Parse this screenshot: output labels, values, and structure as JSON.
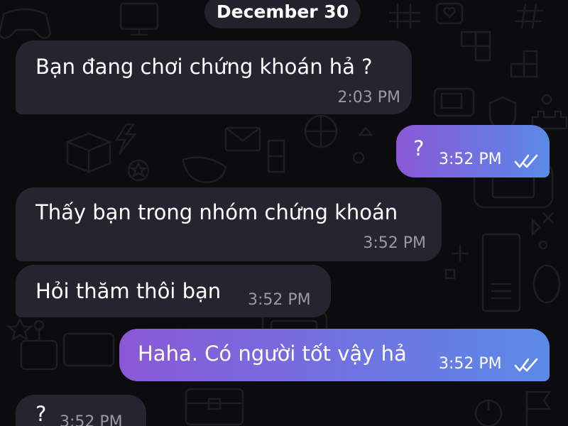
{
  "date_separator": "December 30",
  "messages": [
    {
      "direction": "incoming",
      "text": "Bạn đang chơi chứng khoán hả ?",
      "time": "2:03 PM"
    },
    {
      "direction": "outgoing",
      "text": "?",
      "time": "3:52 PM",
      "status": "read"
    },
    {
      "direction": "incoming",
      "text": "Thấy bạn trong nhóm chứng khoán",
      "time": "3:52 PM"
    },
    {
      "direction": "incoming",
      "text": "Hỏi thăm thôi bạn",
      "time": "3:52 PM"
    },
    {
      "direction": "outgoing",
      "text": "Haha. Có người tốt vậy hả",
      "time": "3:52 PM",
      "status": "read"
    },
    {
      "direction": "incoming",
      "text": "?",
      "time": "3:52 PM"
    }
  ],
  "colors": {
    "background": "#0c0c0e",
    "incoming_bubble": "#25252f",
    "outgoing_gradient_start": "#8a58d6",
    "outgoing_gradient_end": "#5b8ae6",
    "incoming_time": "#9a9aa6",
    "doodle_stroke": "#1d1d22"
  },
  "icons": {
    "read_receipt": "double-check-icon",
    "background_pattern": "game-doodle-pattern"
  }
}
